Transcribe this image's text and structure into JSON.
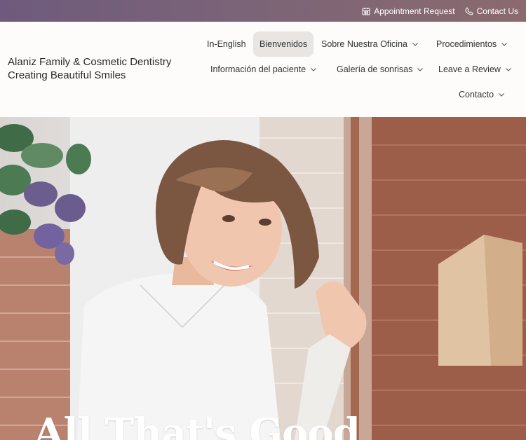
{
  "topbar": {
    "appointment_label": "Appointment Request",
    "contact_label": "Contact Us",
    "gradient_colors": [
      "#6e5a7c",
      "#8a6a6e"
    ]
  },
  "brand": {
    "line1": "Alaniz Family & Cosmetic Dentistry",
    "line2": "Creating Beautiful Smiles"
  },
  "nav": {
    "items": [
      {
        "label": "In-English",
        "has_dropdown": false,
        "active": false
      },
      {
        "label": "Bienvenidos",
        "has_dropdown": false,
        "active": true
      },
      {
        "label": "Sobre Nuestra Oficina",
        "has_dropdown": true,
        "active": false
      },
      {
        "label": "Procedimientos",
        "has_dropdown": true,
        "active": false
      },
      {
        "label": "Información del paciente",
        "has_dropdown": true,
        "active": false
      },
      {
        "label": "Galería de sonrisas",
        "has_dropdown": true,
        "active": false
      },
      {
        "label": "Leave a Review",
        "has_dropdown": true,
        "active": false
      },
      {
        "label": "Contacto",
        "has_dropdown": true,
        "active": false
      }
    ]
  },
  "hero": {
    "title": "All That's Good"
  }
}
